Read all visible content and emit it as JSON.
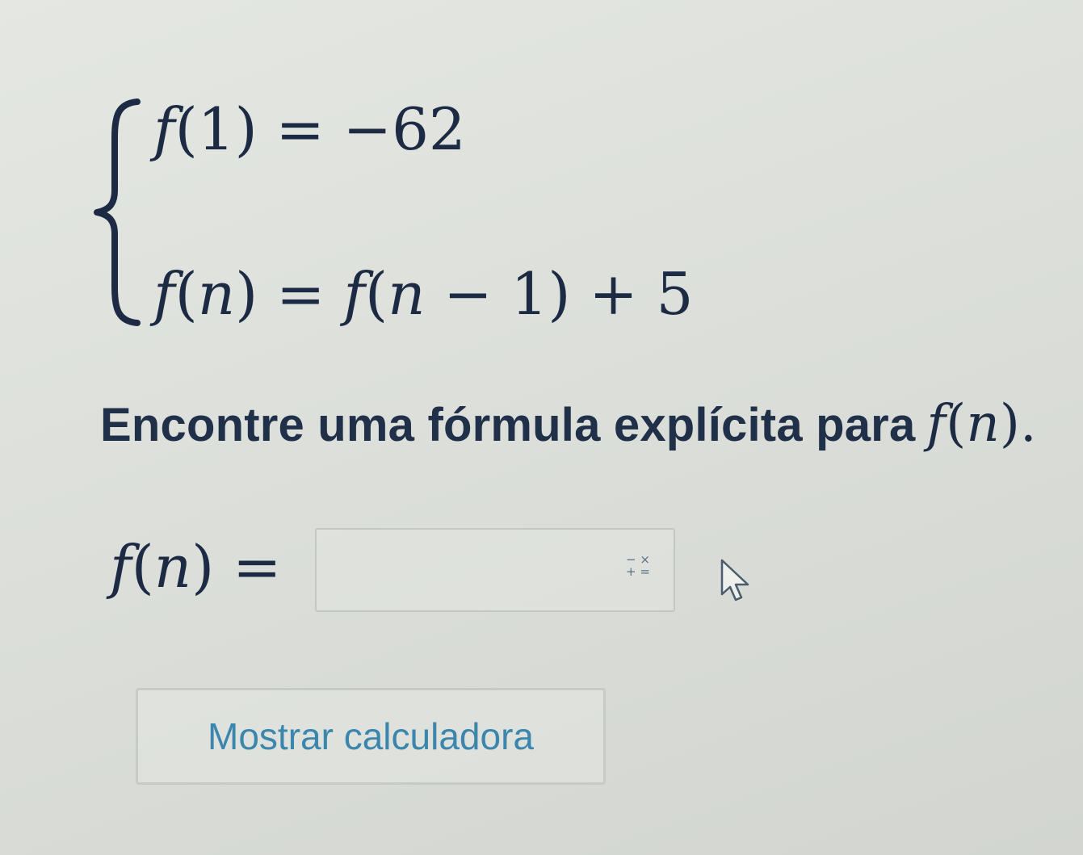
{
  "recursion": {
    "base_case": {
      "lhs_fn": "f",
      "lhs_arg": "1",
      "equals": "=",
      "rhs": "−62"
    },
    "recursive_case": {
      "lhs_fn": "f",
      "lhs_arg": "n",
      "equals": "=",
      "rhs_fn": "f",
      "rhs_arg_var": "n",
      "rhs_arg_rest": " − 1",
      "rhs_tail": " + 5"
    }
  },
  "prompt": {
    "text": "Encontre uma fórmula explícita para",
    "fn": "f",
    "arg": "n",
    "period": "."
  },
  "answer": {
    "label_fn": "f",
    "label_arg": "n",
    "equals": "=",
    "input_value": "",
    "keypad_icon": "math-keypad-icon",
    "keypad_top": "− ×",
    "keypad_bottom": "+ ="
  },
  "calculator_button": {
    "label": "Mostrar calculadora"
  },
  "colors": {
    "text": "#1c2a44",
    "accent": "#3b86ad"
  }
}
